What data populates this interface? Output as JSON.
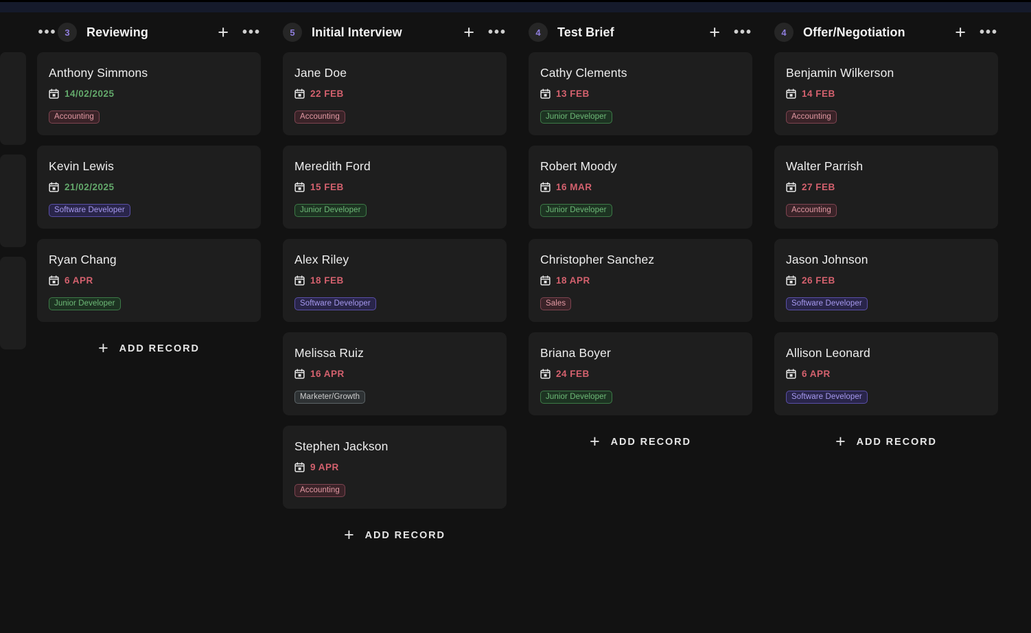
{
  "top_bar": {
    "name": "window-chrome-bar"
  },
  "board": {
    "add_record_label": "ADD RECORD",
    "partial_column": {
      "name": "partial-column-left",
      "ghost_cards": 3
    },
    "columns": [
      {
        "id": "reviewing",
        "title": "Reviewing",
        "count": "3",
        "add_label": "ADD RECORD",
        "show_add": true,
        "cards": [
          {
            "name": "Anthony Simmons",
            "date": "14/02/2025",
            "date_color": "green",
            "tag": "Accounting",
            "tag_color": "pink"
          },
          {
            "name": "Kevin Lewis",
            "date": "21/02/2025",
            "date_color": "green",
            "tag": "Software Developer",
            "tag_color": "purple"
          },
          {
            "name": "Ryan Chang",
            "date": "6 APR",
            "date_color": "red",
            "tag": "Junior Developer",
            "tag_color": "green"
          }
        ]
      },
      {
        "id": "initial-interview",
        "title": "Initial Interview",
        "count": "5",
        "add_label": "ADD RECORD",
        "show_add": true,
        "cards": [
          {
            "name": "Jane Doe",
            "date": "22 FEB",
            "date_color": "red",
            "tag": "Accounting",
            "tag_color": "pink"
          },
          {
            "name": "Meredith Ford",
            "date": "15 FEB",
            "date_color": "red",
            "tag": "Junior Developer",
            "tag_color": "green"
          },
          {
            "name": "Alex Riley",
            "date": "18 FEB",
            "date_color": "red",
            "tag": "Software Developer",
            "tag_color": "purple"
          },
          {
            "name": "Melissa Ruiz",
            "date": "16 APR",
            "date_color": "red",
            "tag": "Marketer/Growth",
            "tag_color": "gray"
          },
          {
            "name": "Stephen Jackson",
            "date": "9 APR",
            "date_color": "red",
            "tag": "Accounting",
            "tag_color": "pink"
          }
        ]
      },
      {
        "id": "test-brief",
        "title": "Test Brief",
        "count": "4",
        "add_label": "ADD RECORD",
        "show_add": true,
        "cards": [
          {
            "name": "Cathy Clements",
            "date": "13 FEB",
            "date_color": "red",
            "tag": "Junior Developer",
            "tag_color": "green"
          },
          {
            "name": "Robert Moody",
            "date": "16 MAR",
            "date_color": "red",
            "tag": "Junior Developer",
            "tag_color": "green"
          },
          {
            "name": "Christopher Sanchez",
            "date": "18 APR",
            "date_color": "red",
            "tag": "Sales",
            "tag_color": "pink"
          },
          {
            "name": "Briana Boyer",
            "date": "24 FEB",
            "date_color": "red",
            "tag": "Junior Developer",
            "tag_color": "green"
          }
        ]
      },
      {
        "id": "offer-negotiation",
        "title": "Offer/Negotiation",
        "count": "4",
        "add_label": "ADD RECORD",
        "show_add": true,
        "cards": [
          {
            "name": "Benjamin Wilkerson",
            "date": "14 FEB",
            "date_color": "red",
            "tag": "Accounting",
            "tag_color": "pink"
          },
          {
            "name": "Walter Parrish",
            "date": "27 FEB",
            "date_color": "red",
            "tag": "Accounting",
            "tag_color": "pink"
          },
          {
            "name": "Jason Johnson",
            "date": "26 FEB",
            "date_color": "red",
            "tag": "Software Developer",
            "tag_color": "purple"
          },
          {
            "name": "Allison Leonard",
            "date": "6 APR",
            "date_color": "red",
            "tag": "Software Developer",
            "tag_color": "purple"
          }
        ]
      }
    ]
  },
  "icons": {
    "plus": "+",
    "ellipsis": "•••",
    "calendar": "calendar-icon"
  },
  "colors": {
    "page_bg": "#121212",
    "card_bg": "#1e1e1e",
    "accent_purple": "#8e7ddb",
    "date_green": "#63a96b",
    "date_red": "#d4616e",
    "top_bar": "#151a2b"
  }
}
